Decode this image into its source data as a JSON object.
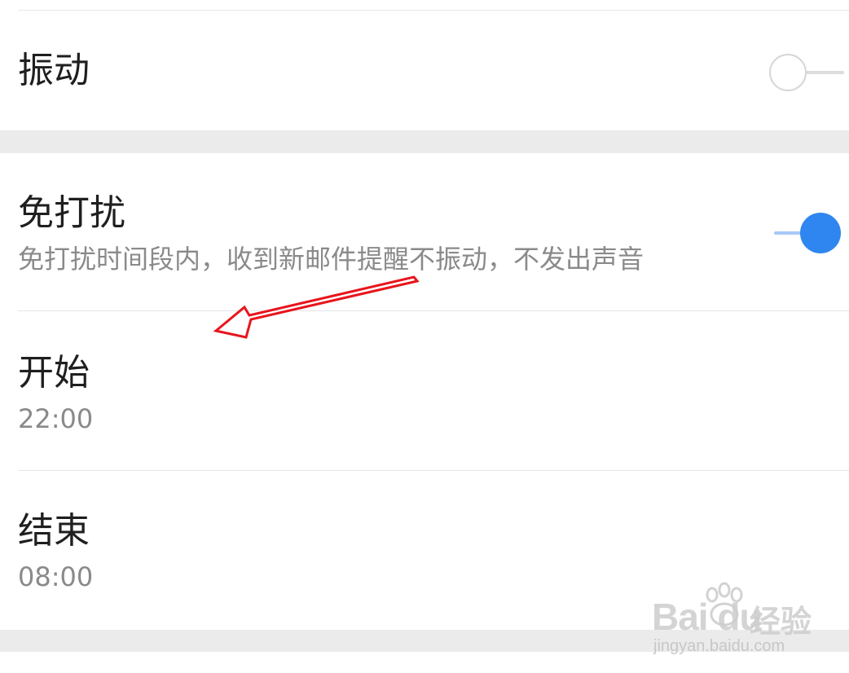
{
  "settings": {
    "vibrate": {
      "title": "振动",
      "enabled": false
    },
    "dnd": {
      "title": "免打扰",
      "description": "免打扰时间段内，收到新邮件提醒不振动，不发出声音",
      "enabled": true
    },
    "start": {
      "title": "开始",
      "value": "22:00"
    },
    "end": {
      "title": "结束",
      "value": "08:00"
    }
  },
  "watermark": {
    "brand": "Bai du",
    "brand_cn": "经验",
    "url": "jingyan.baidu.com"
  },
  "colors": {
    "accent": "#2f86f0",
    "track_on": "#a8c8f8",
    "annotation": "#e8141c"
  }
}
